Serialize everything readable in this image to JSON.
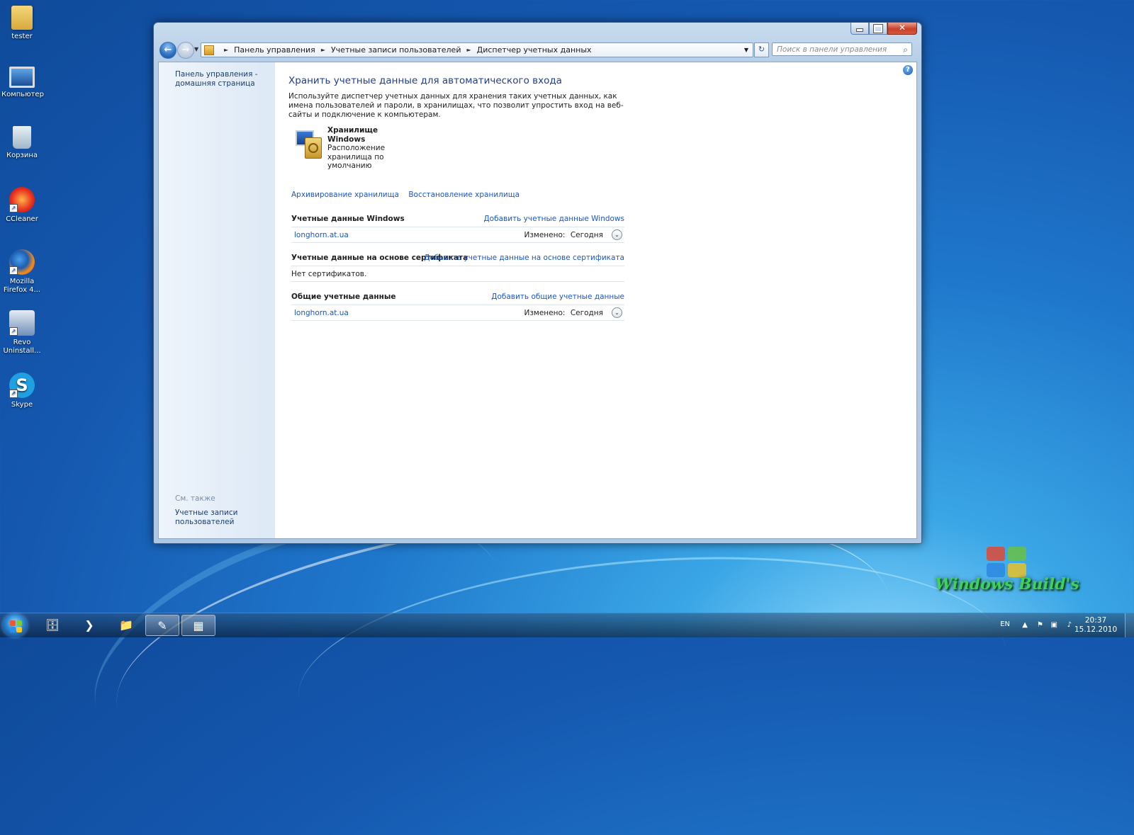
{
  "desktop": {
    "icons": [
      {
        "label": "tester",
        "icon": "folder-icon"
      },
      {
        "label": "Компьютер",
        "icon": "computer-icon"
      },
      {
        "label": "Корзина",
        "icon": "recycle-bin-icon"
      },
      {
        "label": "CCleaner",
        "icon": "ccleaner-icon"
      },
      {
        "label": "Mozilla Firefox 4...",
        "icon": "firefox-icon"
      },
      {
        "label": "Revo Uninstall...",
        "icon": "revo-uninstaller-icon"
      },
      {
        "label": "Skype",
        "icon": "skype-icon"
      }
    ],
    "watermark": "Windows Build's"
  },
  "window": {
    "breadcrumb": [
      "Панель управления",
      "Учетные записи пользователей",
      "Диспетчер учетных данных"
    ],
    "search_placeholder": "Поиск в панели управления",
    "sidebar": {
      "home_link": "Панель управления - домашняя страница",
      "see_also": "См. также",
      "accounts_link": "Учетные записи пользователей"
    },
    "main": {
      "title": "Хранить учетные данные для автоматического входа",
      "description": "Используйте диспетчер учетных данных для хранения таких учетных данных, как имена пользователей и пароли, в хранилищах, что позволит упростить вход на веб-сайты и подключение к компьютерам.",
      "vault": {
        "title": "Хранилище Windows",
        "subtitle": "Расположение хранилища по умолчанию"
      },
      "backup_link": "Архивирование хранилища",
      "restore_link": "Восстановление хранилища",
      "sections": {
        "windows": {
          "title": "Учетные данные Windows",
          "add_link": "Добавить учетные данные Windows",
          "entry": {
            "name": "longhorn.at.ua",
            "modified_label": "Изменено:",
            "modified_value": "Сегодня"
          }
        },
        "certificate": {
          "title": "Учетные данные на основе сертификата",
          "add_link": "Добавить учетные данные на основе сертификата",
          "empty_text": "Нет сертификатов."
        },
        "generic": {
          "title": "Общие учетные данные",
          "add_link": "Добавить общие учетные данные",
          "entry": {
            "name": "longhorn.at.ua",
            "modified_label": "Изменено:",
            "modified_value": "Сегодня"
          }
        }
      }
    }
  },
  "taskbar": {
    "language": "EN",
    "time": "20:37",
    "date": "15.12.2010",
    "buttons": [
      "start-orb",
      "explorer-icon",
      "powershell-icon",
      "folder-icon",
      "ccleaner-icon",
      "control-panel-icon"
    ]
  },
  "colors": {
    "link": "#1b56c6",
    "title": "#1e3e8e",
    "desktop_blue": "#1f78cc",
    "watermark_green": "#3fd15a"
  }
}
